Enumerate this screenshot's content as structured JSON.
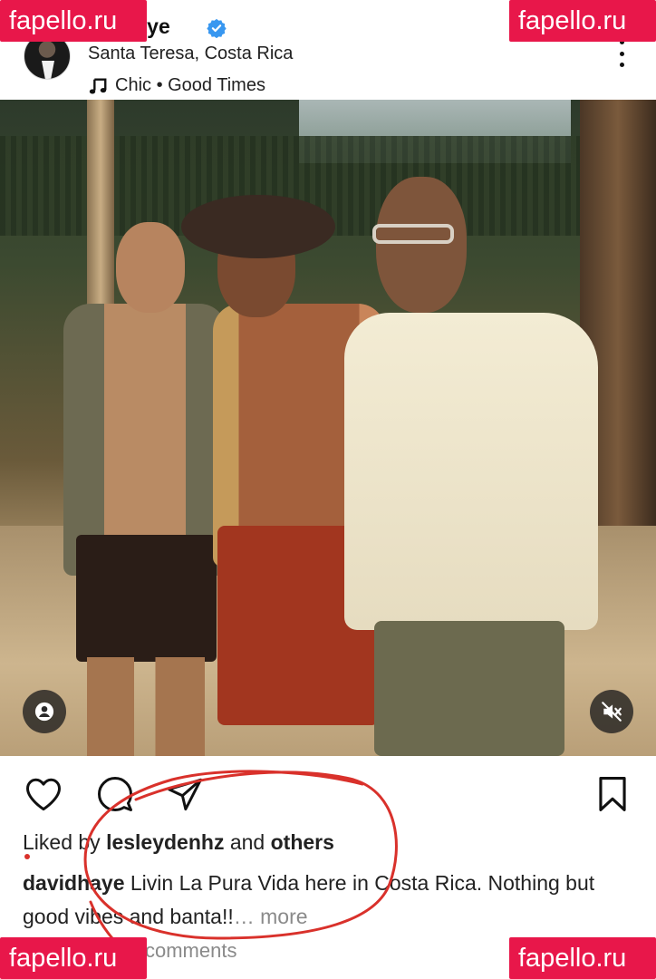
{
  "post": {
    "username": "davidhaye",
    "username_visible": "···dhaye",
    "location": "Santa Teresa, Costa Rica",
    "music": "Chic • Good Times",
    "liked_prefix": "Liked by ",
    "liked_user": "lesleydenhz",
    "liked_mid": " and ",
    "liked_others": "others",
    "caption_user": "davidhaye",
    "caption_text": " Livin La Pura Vida here in Costa Rica. Nothing but good vibes and banta!!",
    "more_label": "… more",
    "comments_text": "comments"
  },
  "icons": {
    "verified": "verified-badge-icon",
    "music": "music-note-icon",
    "more": "more-options-icon",
    "like": "heart-icon",
    "comment": "comment-icon",
    "share": "send-icon",
    "save": "bookmark-icon",
    "tags": "user-tag-icon",
    "mute": "muted-speaker-icon"
  },
  "colors": {
    "verified": "#3897f0",
    "watermark": "#e8174a",
    "annotation": "#d9312b"
  },
  "watermark": {
    "text": "fapello.ru"
  }
}
